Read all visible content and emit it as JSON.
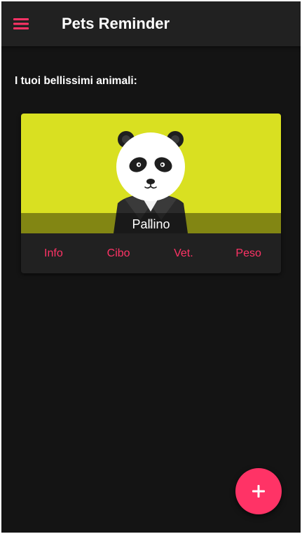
{
  "app_bar": {
    "title": "Pets Reminder",
    "menu_icon": "hamburger-menu-icon"
  },
  "main": {
    "heading": "I tuoi bellissimi animali:"
  },
  "pet_card": {
    "name": "Pallino",
    "image": "panda-avatar",
    "image_background_color": "#d9e021",
    "actions": [
      {
        "label": "Info"
      },
      {
        "label": "Cibo"
      },
      {
        "label": "Vet."
      },
      {
        "label": "Peso"
      }
    ]
  },
  "fab": {
    "icon": "plus-icon"
  },
  "colors": {
    "accent": "#ff3366",
    "background": "#141414",
    "app_bar": "#212121",
    "card": "#212121"
  }
}
